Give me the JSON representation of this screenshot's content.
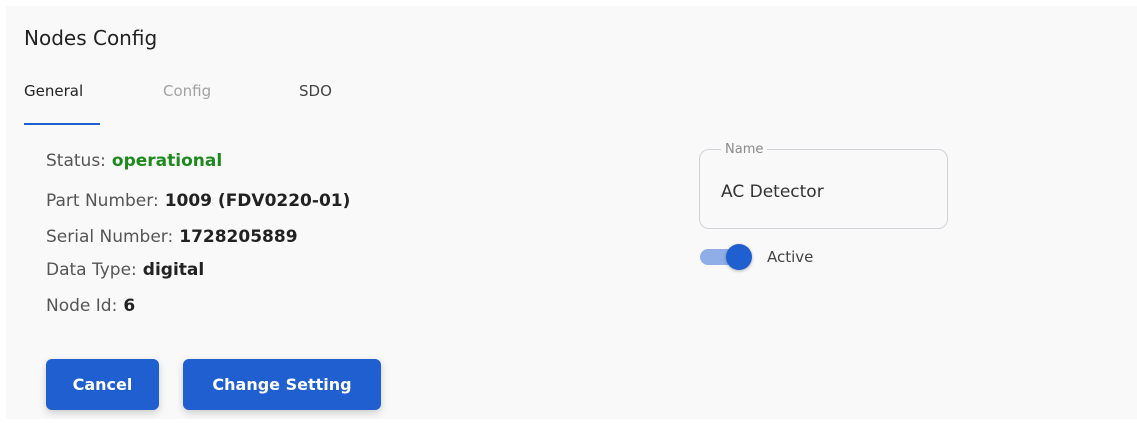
{
  "page": {
    "title": "Nodes Config"
  },
  "tabs": [
    {
      "label": "General",
      "active": true
    },
    {
      "label": "Config",
      "active": false
    },
    {
      "label": "SDO",
      "active": false
    }
  ],
  "info": {
    "status": {
      "label": "Status:",
      "value": "operational"
    },
    "part_number": {
      "label": "Part Number:",
      "value": "1009 (FDV0220-01)"
    },
    "serial_number": {
      "label": "Serial Number:",
      "value": "1728205889"
    },
    "data_type": {
      "label": "Data Type:",
      "value": "digital"
    },
    "node_id": {
      "label": "Node Id:",
      "value": "6"
    }
  },
  "form": {
    "name_label": "Name",
    "name_value": "AC Detector",
    "active_label": "Active",
    "active_on": true
  },
  "buttons": {
    "cancel": "Cancel",
    "change_setting": "Change Setting"
  },
  "colors": {
    "accent": "#1f5fd0",
    "status_ok": "#1e8a1e",
    "toggle_track": "#8faee8"
  }
}
